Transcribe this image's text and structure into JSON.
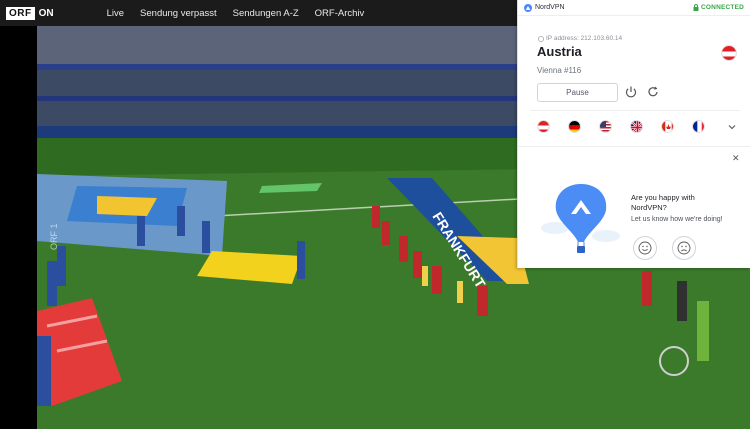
{
  "orf": {
    "logo_box": "ORF",
    "logo_on": "ON",
    "nav": [
      "Live",
      "Sendung verpasst",
      "Sendungen A-Z",
      "ORF-Archiv"
    ]
  },
  "video": {
    "watermark": "ORF 1",
    "banner_text": "FRANKFURT"
  },
  "vpn": {
    "brand": "NordVPN",
    "status": "CONNECTED",
    "status_color": "#3aa64b",
    "ip_label": "IP address: 212.103.60.14",
    "country": "Austria",
    "server": "Vienna #116",
    "pause_label": "Pause",
    "flags": [
      "austria-flag",
      "germany-flag",
      "usa-flag",
      "uk-flag",
      "canada-flag",
      "france-flag"
    ],
    "promo_question": "Are you happy with NordVPN?",
    "promo_sub": "Let us know how we're doing!"
  }
}
